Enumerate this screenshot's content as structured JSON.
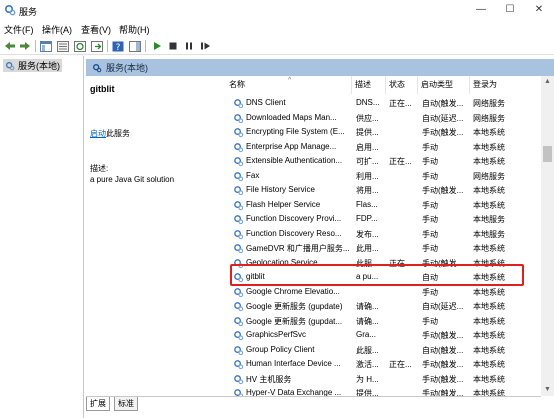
{
  "window": {
    "title": "服务",
    "minimize": "—",
    "maximize": "☐",
    "close": "✕"
  },
  "menu": [
    "文件(F)",
    "操作(A)",
    "查看(V)",
    "帮助(H)"
  ],
  "tree": {
    "root": "服务(本地)"
  },
  "header": {
    "title": "服务(本地)"
  },
  "detail": {
    "service_name": "gitblit",
    "start_link": "启动",
    "start_suffix": "此服务",
    "desc_label": "描述:",
    "desc_text": "a pure Java Git solution"
  },
  "columns": [
    "名称",
    "描述",
    "状态",
    "启动类型",
    "登录为"
  ],
  "rows": [
    [
      "DNS Client",
      "DNS...",
      "正在...",
      "自动(触发...",
      "网络服务"
    ],
    [
      "Downloaded Maps Man...",
      "供应...",
      "",
      "自动(延迟...",
      "网络服务"
    ],
    [
      "Encrypting File System (E...",
      "提供...",
      "",
      "手动(触发...",
      "本地系统"
    ],
    [
      "Enterprise App Manage...",
      "启用...",
      "",
      "手动",
      "本地系统"
    ],
    [
      "Extensible Authentication...",
      "可扩...",
      "正在...",
      "手动",
      "本地系统"
    ],
    [
      "Fax",
      "利用...",
      "",
      "手动",
      "网络服务"
    ],
    [
      "File History Service",
      "将用...",
      "",
      "手动(触发...",
      "本地系统"
    ],
    [
      "Flash Helper Service",
      "Flas...",
      "",
      "手动",
      "本地系统"
    ],
    [
      "Function Discovery Provi...",
      "FDP...",
      "",
      "手动",
      "本地服务"
    ],
    [
      "Function Discovery Reso...",
      "发布...",
      "",
      "手动",
      "本地服务"
    ],
    [
      "GameDVR 和广播用户服务...",
      "此用...",
      "",
      "手动",
      "本地系统"
    ],
    [
      "Geolocation Service",
      "此服...",
      "正在...",
      "手动(触发...",
      "本地系统"
    ],
    [
      "gitblit",
      "a pu...",
      "",
      "自动",
      "本地系统"
    ],
    [
      "Google Chrome Elevatio...",
      "",
      "",
      "手动",
      "本地系统"
    ],
    [
      "Google 更新服务 (gupdate)",
      "请确...",
      "",
      "自动(延迟...",
      "本地系统"
    ],
    [
      "Google 更新服务 (gupdat...",
      "请确...",
      "",
      "手动",
      "本地系统"
    ],
    [
      "GraphicsPerfSvc",
      "Gra...",
      "",
      "手动(触发...",
      "本地系统"
    ],
    [
      "Group Policy Client",
      "此服...",
      "",
      "自动(触发...",
      "本地系统"
    ],
    [
      "Human Interface Device ...",
      "激活...",
      "正在...",
      "手动(触发...",
      "本地系统"
    ],
    [
      "HV 主机服务",
      "为 H...",
      "",
      "手动(触发...",
      "本地系统"
    ],
    [
      "Hyper-V Data Exchange ...",
      "提供...",
      "",
      "手动(触发...",
      "本地系统"
    ]
  ],
  "tabs": [
    "扩展",
    "标准"
  ],
  "colors": {
    "header_band": "#a8c2e0",
    "highlight_border": "#e02020",
    "link": "#0563c1"
  }
}
